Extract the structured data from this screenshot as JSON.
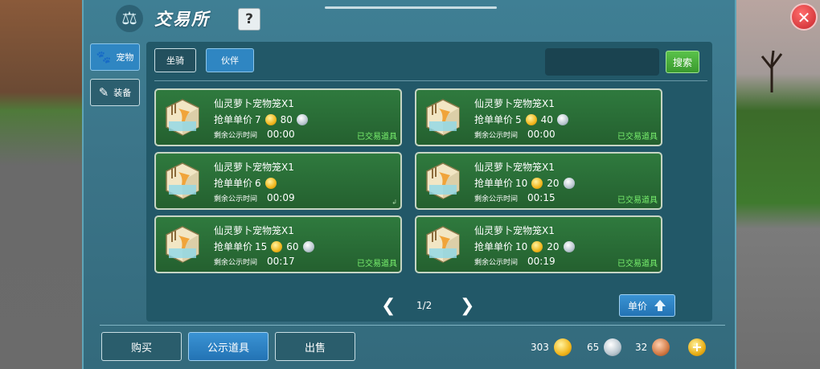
{
  "window": {
    "title": "交易所",
    "help_label": "?",
    "close_label": "✕"
  },
  "side_tabs": [
    {
      "label": "宠物",
      "icon": "paw-icon",
      "active": true
    },
    {
      "label": "装备",
      "icon": "equipment-icon",
      "active": false
    }
  ],
  "sub_tabs": [
    {
      "label": "坐骑",
      "active": false
    },
    {
      "label": "伙伴",
      "active": true
    }
  ],
  "search": {
    "value": "",
    "placeholder": "",
    "button_label": "搜索"
  },
  "price_label": "抢单单价",
  "time_label": "剩余公示时间",
  "items": [
    {
      "name": "仙灵萝卜宠物笼X1",
      "gold": "7",
      "silver": "80",
      "time": "00:00",
      "status": "已交易道具"
    },
    {
      "name": "仙灵萝卜宠物笼X1",
      "gold": "5",
      "silver": "40",
      "time": "00:00",
      "status": "已交易道具"
    },
    {
      "name": "仙灵萝卜宠物笼X1",
      "gold": "6",
      "silver": "",
      "time": "00:09",
      "status": ""
    },
    {
      "name": "仙灵萝卜宠物笼X1",
      "gold": "10",
      "silver": "20",
      "time": "00:15",
      "status": "已交易道具"
    },
    {
      "name": "仙灵萝卜宠物笼X1",
      "gold": "15",
      "silver": "60",
      "time": "00:17",
      "status": "已交易道具"
    },
    {
      "name": "仙灵萝卜宠物笼X1",
      "gold": "10",
      "silver": "20",
      "time": "00:19",
      "status": "已交易道具"
    }
  ],
  "pager": {
    "text": "1/2",
    "prev": "❮",
    "next": "❯"
  },
  "sort_button": {
    "label": "单价"
  },
  "bottom_tabs": [
    {
      "label": "购买",
      "active": false
    },
    {
      "label": "公示道具",
      "active": true
    },
    {
      "label": "出售",
      "active": false
    }
  ],
  "currency": {
    "gold": "303",
    "silver": "65",
    "bronze": "32"
  },
  "colors": {
    "panel": "#3b7488",
    "card": "#2a6c37",
    "accent_blue": "#2f86c2",
    "status_green": "#79f06e",
    "close_red": "#c7262b"
  }
}
